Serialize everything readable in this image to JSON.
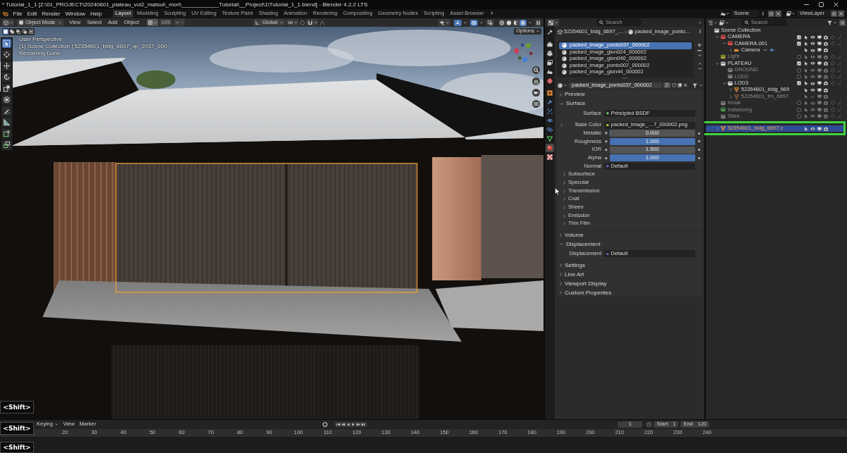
{
  "window": {
    "title": "* Tutorial_1_1 [Z:\\01_PROJECT\\20240601_plateau_vol2_matsui\\_mori\\____________Tutorial\\__Project\\1\\Tutorial_1_1.blend] - Blender 4.2.2 LTS"
  },
  "menu": [
    "File",
    "Edit",
    "Render",
    "Window",
    "Help"
  ],
  "workspaces": [
    {
      "label": "Layout",
      "selected": true
    },
    {
      "label": "Modeling",
      "selected": false
    },
    {
      "label": "Sculpting",
      "selected": false
    },
    {
      "label": "UV Editing",
      "selected": false
    },
    {
      "label": "Texture Paint",
      "selected": false
    },
    {
      "label": "Shading",
      "selected": false
    },
    {
      "label": "Animation",
      "selected": false
    },
    {
      "label": "Rendering",
      "selected": false
    },
    {
      "label": "Compositing",
      "selected": false
    },
    {
      "label": "Geometry Nodes",
      "selected": false
    },
    {
      "label": "Scripting",
      "selected": false
    },
    {
      "label": "Asset Browser",
      "selected": false
    }
  ],
  "add_workspace": "+",
  "scene": {
    "name": "Scene"
  },
  "view_layer": {
    "name": "ViewLayer"
  },
  "viewport": {
    "mode": "Object Mode",
    "menus": [
      "View",
      "Select",
      "Add",
      "Object"
    ],
    "gis": "GIS",
    "orientation": "Global",
    "toggles": [
      {
        "kind": "gizmo",
        "on": true
      },
      {
        "kind": "overlay",
        "on": true
      },
      {
        "kind": "xray",
        "on": false
      }
    ],
    "shading": [
      {
        "kind": "wireframe",
        "selected": false
      },
      {
        "kind": "solid",
        "selected": false
      },
      {
        "kind": "material",
        "selected": false
      },
      {
        "kind": "rendered",
        "selected": true
      }
    ],
    "options": "Options",
    "overlay_text": [
      "User Perspective",
      "(1) Scene Collection | 52354601_bldg_6697_op_2037_000",
      "Rendering Done"
    ],
    "select_modes": [
      {
        "kind": "set",
        "selected": true
      },
      {
        "kind": "extend",
        "selected": false
      },
      {
        "kind": "subtract",
        "selected": false
      },
      {
        "kind": "invert",
        "selected": false
      },
      {
        "kind": "intersect",
        "selected": false
      }
    ],
    "tools": [
      {
        "kind": "select",
        "selected": true
      },
      {
        "kind": "cursor",
        "selected": false
      },
      {
        "kind": "move",
        "selected": false
      },
      {
        "kind": "rotate",
        "selected": false
      },
      {
        "kind": "scale",
        "selected": false
      },
      {
        "kind": "transform",
        "selected": false
      },
      {
        "kind": "annotate",
        "selected": false
      },
      {
        "kind": "measure",
        "selected": false
      },
      {
        "kind": "add-cube",
        "selected": false
      },
      {
        "kind": "extrude",
        "selected": false
      }
    ]
  },
  "properties": {
    "search": {
      "placeholder": "Search"
    },
    "tabs": [
      {
        "kind": "tool",
        "selected": false
      },
      {
        "kind": "render",
        "selected": false
      },
      {
        "kind": "output",
        "selected": false
      },
      {
        "kind": "view-layer",
        "selected": false
      },
      {
        "kind": "scene",
        "selected": false
      },
      {
        "kind": "world",
        "selected": false
      },
      {
        "kind": "object",
        "selected": false
      },
      {
        "kind": "modifier",
        "selected": false
      },
      {
        "kind": "particles",
        "selected": false
      },
      {
        "kind": "physics",
        "selected": false
      },
      {
        "kind": "constraint",
        "selected": false
      },
      {
        "kind": "data",
        "selected": false
      },
      {
        "kind": "material",
        "selected": true
      },
      {
        "kind": "texture",
        "selected": false
      }
    ],
    "breadcrumb": [
      "52354601_bldg_6697_…",
      "packed_image_ponto…"
    ],
    "slots": [
      {
        "name": "packed_image_ponto037_000002",
        "selected": true
      },
      {
        "name": "packed_image_gion024_000002",
        "selected": false
      },
      {
        "name": "packed_image_gion040_000002",
        "selected": false
      },
      {
        "name": "packed_image_ponto007_000002",
        "selected": false
      },
      {
        "name": "packed_image_gion44_000002",
        "selected": false
      }
    ],
    "material": {
      "name": "packed_image_ponto037_000002",
      "users": "2"
    },
    "panels": [
      {
        "title": "Preview",
        "expanded": false
      },
      {
        "title": "Surface",
        "expanded": true,
        "fields": [
          {
            "kind": "shader",
            "label": "Surface",
            "value": "Principled BSDF",
            "color": "#63c763"
          },
          {
            "kind": "link",
            "label": "Base Color",
            "value": "packed_image_…7_000002.png",
            "color": "#c7c729",
            "expanded": false
          },
          {
            "kind": "slider",
            "label": "Metallic",
            "value": "0.000",
            "level": 0,
            "color": "#a1a1a1"
          },
          {
            "kind": "slider",
            "label": "Roughness",
            "value": "1.000",
            "level": 1,
            "color": "#a1a1a1"
          },
          {
            "kind": "number",
            "label": "IOR",
            "value": "1.500",
            "color": "#a1a1a1"
          },
          {
            "kind": "slider",
            "label": "Alpha",
            "value": "1.000",
            "level": 1,
            "color": "#a1a1a1"
          },
          {
            "kind": "link",
            "label": "Normal",
            "value": "Default",
            "color": "#6363c7"
          }
        ],
        "subpanels": [
          {
            "title": "Subsurface",
            "expanded": false
          },
          {
            "title": "Specular",
            "expanded": false
          },
          {
            "title": "Transmission",
            "expanded": false
          },
          {
            "title": "Coat",
            "expanded": false
          },
          {
            "title": "Sheen",
            "expanded": false
          },
          {
            "title": "Emission",
            "expanded": false
          },
          {
            "title": "Thin Film",
            "expanded": false
          }
        ]
      },
      {
        "title": "Volume",
        "expanded": false
      },
      {
        "title": "Displacement",
        "expanded": true,
        "fields": [
          {
            "kind": "link",
            "label": "Displacement",
            "value": "Default",
            "color": "#6363c7"
          }
        ]
      },
      {
        "title": "Settings",
        "expanded": false
      },
      {
        "title": "Line Art",
        "expanded": false
      },
      {
        "title": "Viewport Display",
        "expanded": false
      },
      {
        "title": "Custom Properties",
        "expanded": false
      }
    ]
  },
  "outliner": {
    "search": {
      "placeholder": "Search"
    },
    "tree": [
      {
        "name": "Scene Collection",
        "kind": "scene",
        "selected": false,
        "children": [
          {
            "name": "CAMERA",
            "kind": "collection",
            "color": "#e2504e",
            "checked": true,
            "selected": false,
            "expanded": true,
            "children": [
              {
                "name": "CAMERA.001",
                "kind": "collection",
                "color": "#e2504e",
                "checked": true,
                "selected": false,
                "expanded": true,
                "children": [
                  {
                    "name": "Camera",
                    "kind": "camera",
                    "visible": true,
                    "selected": false,
                    "expanded": false
                  }
                ]
              }
            ]
          },
          {
            "name": "Light",
            "kind": "collection",
            "color": "#a9a83a",
            "checked": false,
            "selected": false
          },
          {
            "name": "PLATEAU",
            "kind": "collection",
            "checked": true,
            "selected": false,
            "expanded": true,
            "children": [
              {
                "name": "GROUND",
                "kind": "collection",
                "checked": false,
                "selected": false
              },
              {
                "name": "LOD2",
                "kind": "collection",
                "checked": false,
                "selected": false
              },
              {
                "name": "LOD3",
                "kind": "collection",
                "checked": true,
                "selected": false,
                "expanded": true,
                "children": [
                  {
                    "name": "52354601_bldg_669",
                    "kind": "mesh",
                    "visible": true,
                    "selected": false,
                    "expanded": false
                  },
                  {
                    "name": "52354601_frn_6697",
                    "kind": "mesh",
                    "visible": false,
                    "selected": false,
                    "expanded": false
                  }
                ]
              }
            ]
          },
          {
            "name": "Kiosk",
            "kind": "collection",
            "checked": false,
            "selected": false
          },
          {
            "name": "Instancing",
            "kind": "collection",
            "color": "#4d9a4d",
            "checked": false,
            "selected": false
          },
          {
            "name": "Sites",
            "kind": "collection",
            "checked": false,
            "selected": false
          },
          {
            "name": "52354601_bldg_6697.c",
            "kind": "mesh",
            "visible": true,
            "selected": true,
            "highlighted": true,
            "expanded": false
          }
        ]
      }
    ]
  },
  "timeline": {
    "keying": "Keying",
    "menus": [
      "View",
      "Marker"
    ],
    "current_frame": "1",
    "start": {
      "label": "Start",
      "value": "1"
    },
    "end": {
      "label": "End",
      "value": "120"
    },
    "ruler": [
      "20",
      "30",
      "40",
      "50",
      "60",
      "70",
      "80",
      "90",
      "100",
      "110",
      "120",
      "130",
      "140",
      "150",
      "160",
      "170",
      "180",
      "190",
      "200",
      "210",
      "220",
      "230",
      "240"
    ]
  },
  "key_overlays": [
    "<Shift>",
    "<Shift>",
    "<Shift>"
  ]
}
